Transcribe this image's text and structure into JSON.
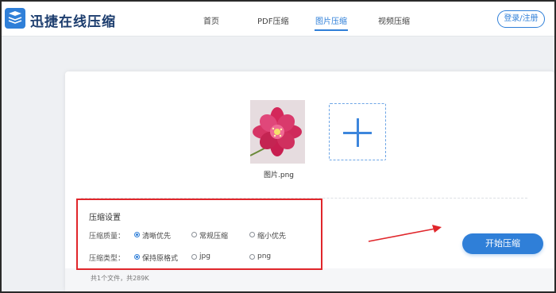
{
  "header": {
    "brand": "迅捷在线压缩",
    "nav": [
      {
        "label": "首页",
        "active": false
      },
      {
        "label": "PDF压缩",
        "active": false
      },
      {
        "label": "图片压缩",
        "active": true
      },
      {
        "label": "视频压缩",
        "active": false
      }
    ],
    "login_label": "登录/注册"
  },
  "upload": {
    "file_name": "图片.png"
  },
  "settings": {
    "title": "压缩设置",
    "quality": {
      "label": "压缩质量：",
      "options": [
        {
          "label": "清晰优先",
          "checked": true
        },
        {
          "label": "常规压缩",
          "checked": false
        },
        {
          "label": "缩小优先",
          "checked": false
        }
      ]
    },
    "type": {
      "label": "压缩类型：",
      "options": [
        {
          "label": "保持原格式",
          "checked": true
        },
        {
          "label": "jpg",
          "checked": false
        },
        {
          "label": "png",
          "checked": false
        }
      ]
    }
  },
  "start_label": "开始压缩",
  "file_summary": "共1个文件，共289K",
  "colors": {
    "accent": "#2f7fd8",
    "annotation_red": "#e0262b"
  }
}
